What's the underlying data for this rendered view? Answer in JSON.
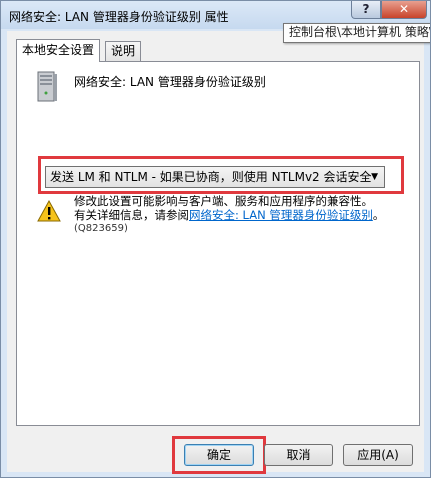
{
  "window": {
    "title": "网络安全: LAN 管理器身份验证级别 属性",
    "help_label": "?",
    "close_label": "✕"
  },
  "tooltip": {
    "text": "控制台根\\本地计算机 策略\\"
  },
  "tabs": [
    {
      "label": "本地安全设置",
      "active": true
    },
    {
      "label": "说明",
      "active": false
    }
  ],
  "policy": {
    "icon": "server-computer-icon",
    "name": "网络安全: LAN 管理器身份验证级别"
  },
  "setting": {
    "selected": "发送 LM 和 NTLM - 如果已协商，则使用 NTLMv2 会话安全",
    "arrow": "▼"
  },
  "warning": {
    "icon": "warning-icon",
    "line1": "修改此设置可能影响与客户端、服务和应用程序的兼容性。",
    "line2_prefix": "有关详细信息，请参阅",
    "link": "网络安全: LAN 管理器身份验证级别",
    "line2_suffix": "。",
    "kb": "(Q823659)"
  },
  "buttons": {
    "ok": "确定",
    "cancel": "取消",
    "apply": "应用(A)"
  },
  "colors": {
    "highlight": "#e0393e",
    "link": "#0066cc",
    "warning": "#f5c21b"
  }
}
